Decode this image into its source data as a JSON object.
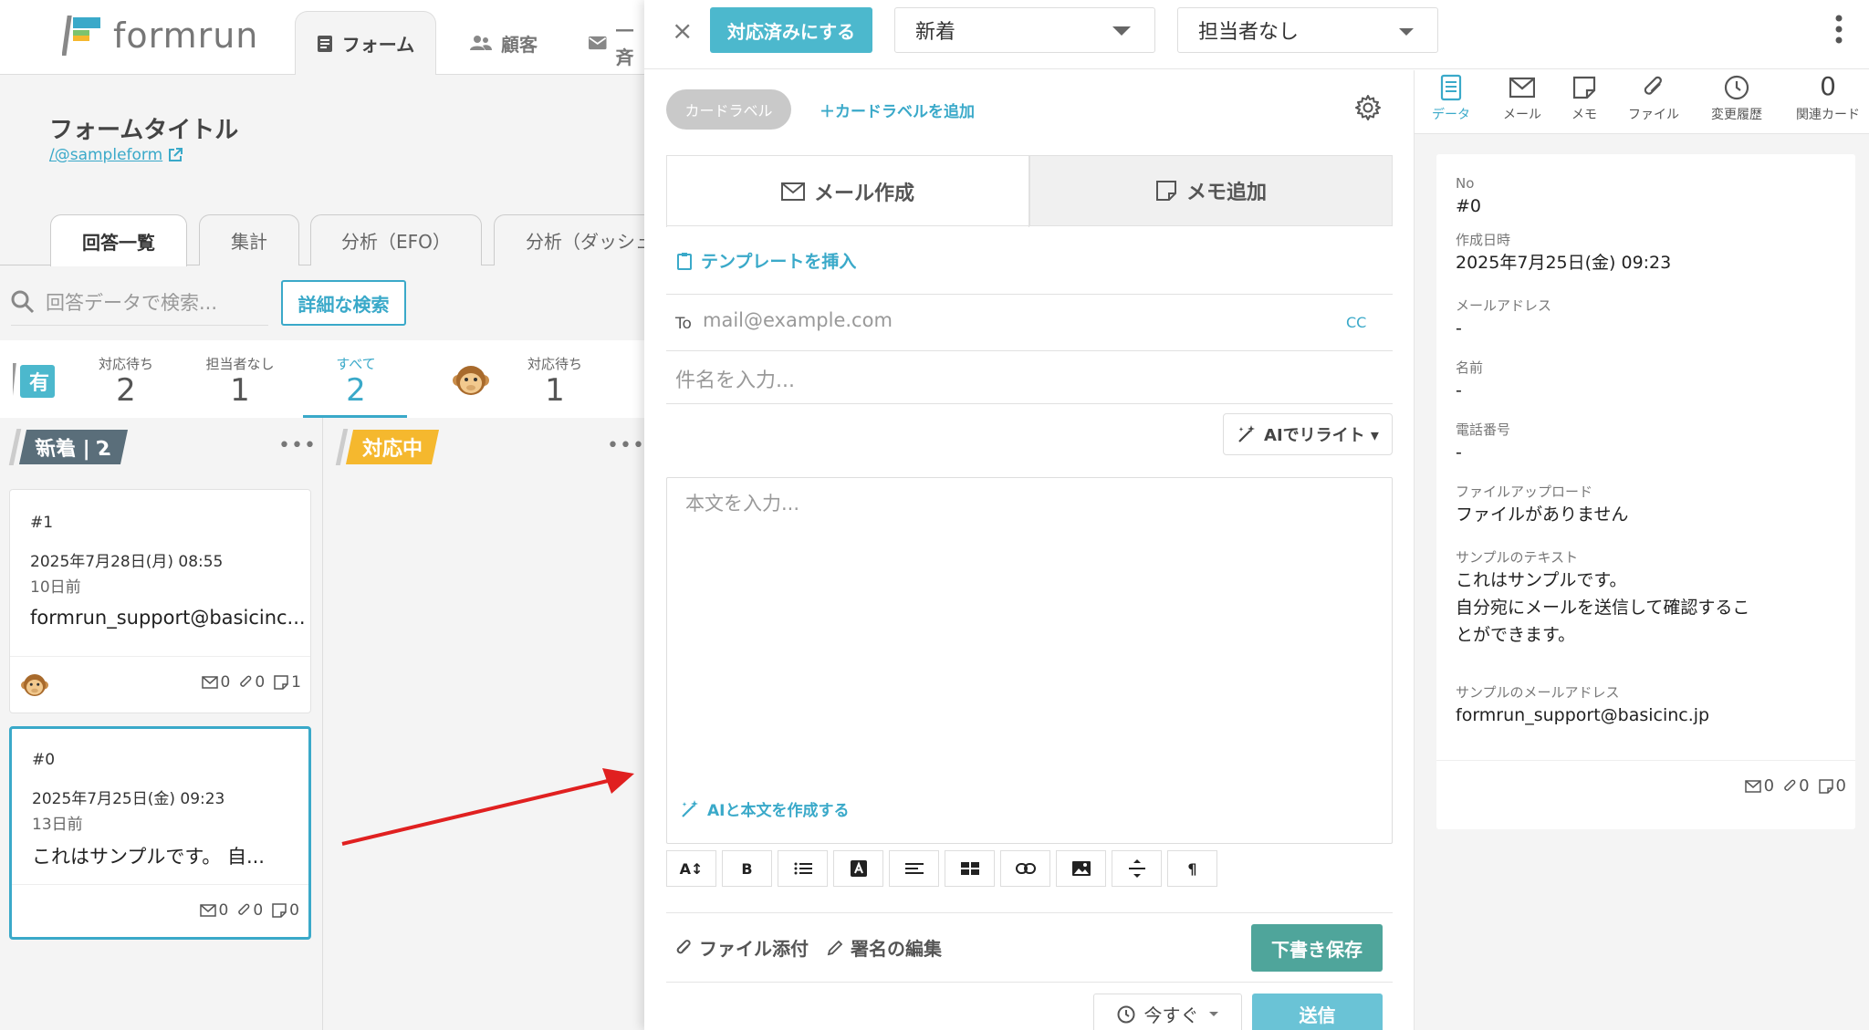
{
  "header": {
    "logo_text": "formrun",
    "tabs": [
      {
        "label": "フォーム"
      },
      {
        "label": "顧客"
      },
      {
        "label": "一斉"
      }
    ]
  },
  "form": {
    "title": "フォームタイトル",
    "link": "/@sampleform"
  },
  "subtabs": [
    "回答一覧",
    "集計",
    "分析（EFO）",
    "分析（ダッシュ"
  ],
  "search": {
    "placeholder": "回答データで検索...",
    "advanced_label": "詳細な検索"
  },
  "status_badge": "有",
  "stats": [
    {
      "label": "対応待ち",
      "value": "2"
    },
    {
      "label": "担当者なし",
      "value": "1"
    },
    {
      "label": "すべて",
      "value": "2"
    },
    {
      "label": "対応待ち",
      "value": "1"
    }
  ],
  "columns": {
    "new": {
      "label": "新着",
      "count": "2"
    },
    "doing": {
      "label": "対応中"
    },
    "more": "•••"
  },
  "cards": [
    {
      "no": "#1",
      "date": "2025年7月28日(月) 08:55",
      "ago": "10日前",
      "text": "formrun_support@basicinc...",
      "mail": "0",
      "attach": "0",
      "memo": "1"
    },
    {
      "no": "#0",
      "date": "2025年7月25日(金) 09:23",
      "ago": "13日前",
      "text": "これはサンプルです。 自...",
      "mail": "0",
      "attach": "0",
      "memo": "0"
    }
  ],
  "panel": {
    "close": "×",
    "resolve_label": "対応済みにする",
    "status_value": "新着",
    "assignee_value": "担当者なし",
    "card_label_chip": "カードラベル",
    "add_card_label": "＋カードラベルを追加",
    "compose_tabs": [
      "メール作成",
      "メモ追加"
    ],
    "template_label": "テンプレートを挿入",
    "to_label": "To",
    "to_placeholder": "mail@example.com",
    "cc_label": "CC",
    "subject_placeholder": "件名を入力...",
    "ai_rewrite_label": "AIでリライト ▾",
    "body_placeholder": "本文を入力...",
    "ai_create_label": "AIと本文を作成する",
    "attach_label": "ファイル添付",
    "signature_label": "署名の編集",
    "draft_label": "下書き保存",
    "schedule_label": "今すぐ",
    "send_label": "送信"
  },
  "right_tabs": [
    {
      "label": "データ",
      "icon": "document-icon"
    },
    {
      "label": "メール",
      "icon": "mail-icon"
    },
    {
      "label": "メモ",
      "icon": "memo-icon"
    },
    {
      "label": "ファイル",
      "icon": "paperclip-icon"
    },
    {
      "label": "変更履歴",
      "icon": "clock-icon"
    },
    {
      "label": "関連カード",
      "count": "0"
    }
  ],
  "data_fields": [
    {
      "key": "No",
      "value": "#0"
    },
    {
      "key": "作成日時",
      "value": "2025年7月25日(金) 09:23"
    },
    {
      "key": "メールアドレス",
      "value": "-"
    },
    {
      "key": "名前",
      "value": "-"
    },
    {
      "key": "電話番号",
      "value": "-"
    },
    {
      "key": "ファイルアップロード",
      "value": "ファイルがありません"
    },
    {
      "key": "サンプルのテキスト",
      "value": "これはサンプルです。\n自分宛にメールを送信して確認するこ\nとができます。"
    },
    {
      "key": "サンプルのメールアドレス",
      "value": "formrun_support@basicinc.jp"
    }
  ],
  "data_counts": {
    "mail": "0",
    "attach": "0",
    "memo": "0"
  },
  "colors": {
    "accent": "#3aa9c9",
    "resolve": "#4cb8cd",
    "draft": "#4fa59b",
    "send": "#6ac3d6",
    "new_col": "#5a6e7a",
    "doing_col": "#f5b82e",
    "arrow": "#e02020"
  }
}
